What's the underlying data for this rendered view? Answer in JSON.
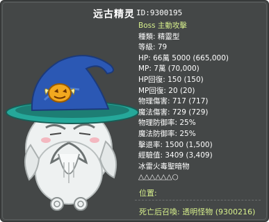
{
  "monster": {
    "name": "远古精灵",
    "id": "ID:9300195"
  },
  "stats": [
    {
      "text": "Boss 主動攻擊",
      "color": "green"
    },
    {
      "text": "種類: 精靈型"
    },
    {
      "text": "等級: 79"
    },
    {
      "text": "HP: 66萬 5000 (665,000)"
    },
    {
      "text": "MP: 7萬 (70,000)"
    },
    {
      "text": "HP回復: 150 (150)"
    },
    {
      "text": "MP回復: 20 (20)"
    },
    {
      "text": "物理傷害: 717 (717)"
    },
    {
      "text": "魔法傷害: 729 (729)"
    },
    {
      "text": "物理防御率: 25%"
    },
    {
      "text": "魔法防御率: 25%"
    },
    {
      "text": "擊退率: 1500 (1,500)"
    },
    {
      "text": "經驗值: 3409 (3,409)"
    },
    {
      "text": "冰雷火毒聖暗物"
    },
    {
      "text": "△△△△△△○"
    }
  ],
  "position_label": "位置:",
  "summon_text": "死亡后召喚: 透明怪物 (9300216)",
  "colors": {
    "panel_bg": "#444747",
    "label_green": "#d7f08c",
    "text_white": "#ffffff",
    "hat_blue": "#2b58b4",
    "ghost_white": "#eef1f1"
  }
}
